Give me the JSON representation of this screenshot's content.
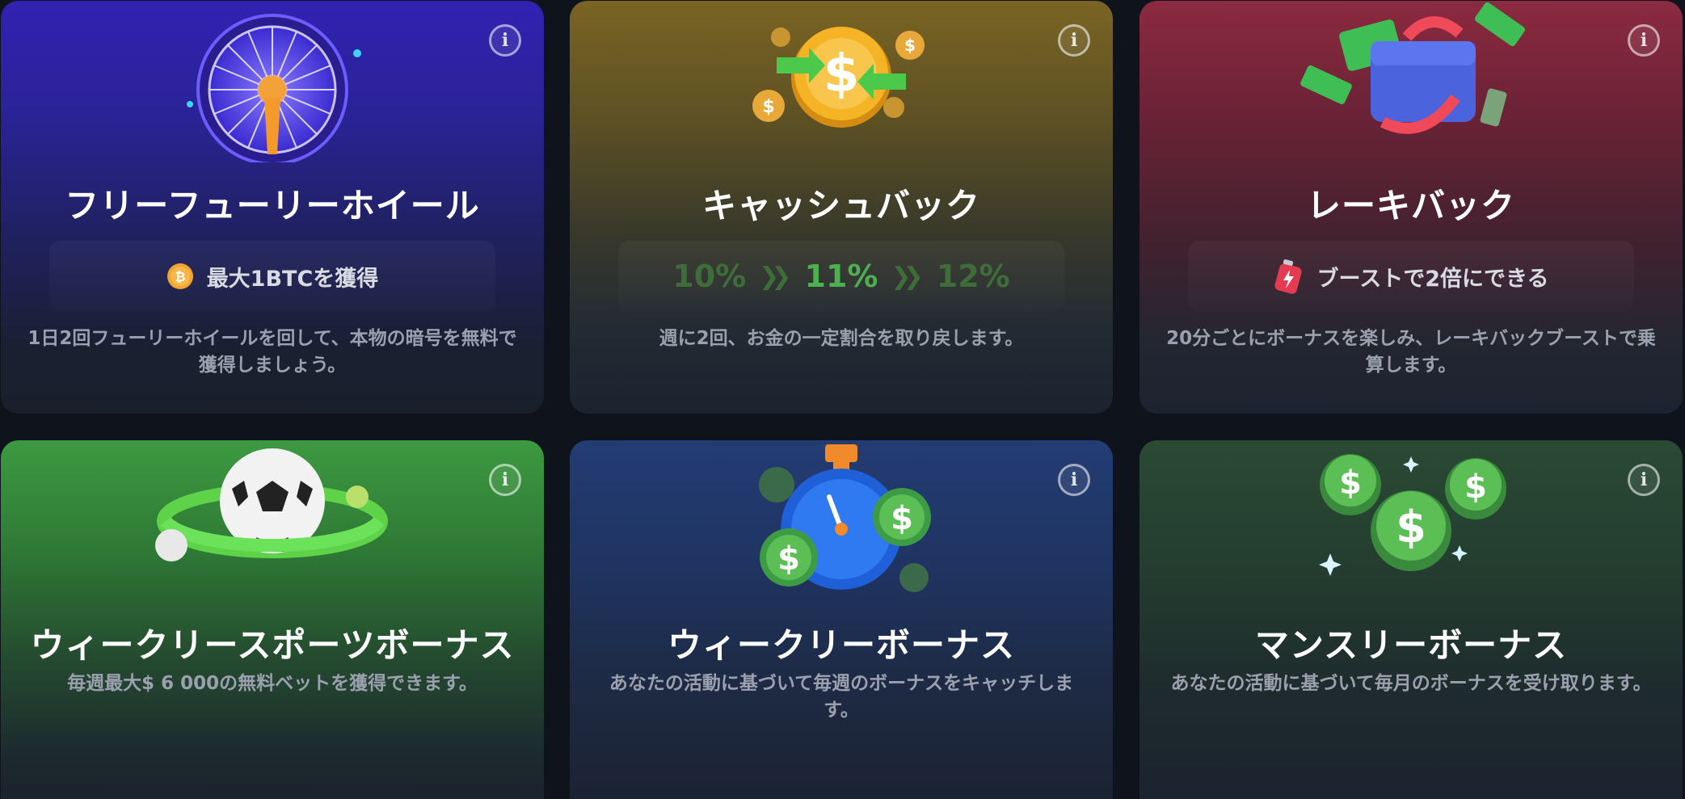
{
  "cards": [
    {
      "title": "フリーフューリーホイール",
      "feature_text": "最大1BTCを獲得",
      "feature_icon": "bitcoin-coin-icon",
      "description": "1日2回フューリーホイールを回して、本物の暗号を無料で獲得しましょう。"
    },
    {
      "title": "キャッシュバック",
      "percentages": [
        "10%",
        "11%",
        "12%"
      ],
      "description": "週に2回、お金の一定割合を取り戻します。"
    },
    {
      "title": "レーキバック",
      "feature_text": "ブーストで2倍にできる",
      "feature_icon": "battery-boost-icon",
      "description": "20分ごとにボーナスを楽しみ、レーキバックブーストで乗算します。"
    },
    {
      "title": "ウィークリースポーツボーナス",
      "description": "毎週最大$ 6 000の無料ベットを獲得できます。"
    },
    {
      "title": "ウィークリーボーナス",
      "description": "あなたの活動に基づいて毎週のボーナスをキャッチします。"
    },
    {
      "title": "マンスリーボーナス",
      "description": "あなたの活動に基づいて毎月のボーナスを受け取ります。"
    }
  ],
  "info_label": "i",
  "colors": {
    "page_bg": "#0f141c",
    "cashback_accent": "#4caf50",
    "cashback_dim": "#3f6d39"
  }
}
